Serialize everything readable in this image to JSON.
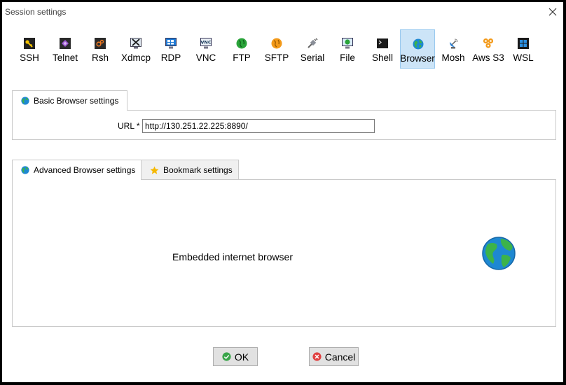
{
  "window": {
    "title": "Session settings"
  },
  "session_types": [
    {
      "label": "SSH",
      "icon": "key-icon"
    },
    {
      "label": "Telnet",
      "icon": "telnet-icon"
    },
    {
      "label": "Rsh",
      "icon": "rsh-icon"
    },
    {
      "label": "Xdmcp",
      "icon": "xdmcp-icon"
    },
    {
      "label": "RDP",
      "icon": "rdp-monitor-icon"
    },
    {
      "label": "VNC",
      "icon": "vnc-monitor-icon"
    },
    {
      "label": "FTP",
      "icon": "ftp-globe-icon"
    },
    {
      "label": "SFTP",
      "icon": "sftp-icon"
    },
    {
      "label": "Serial",
      "icon": "serial-plug-icon"
    },
    {
      "label": "File",
      "icon": "file-monitor-icon"
    },
    {
      "label": "Shell",
      "icon": "shell-terminal-icon"
    },
    {
      "label": "Browser",
      "icon": "browser-globe-icon",
      "selected": true
    },
    {
      "label": "Mosh",
      "icon": "mosh-satellite-icon"
    },
    {
      "label": "Aws S3",
      "icon": "aws-s3-icon"
    },
    {
      "label": "WSL",
      "icon": "windows-icon"
    }
  ],
  "basic": {
    "tab_label": "Basic Browser settings",
    "url_label": "URL *",
    "url_value": "http://130.251.22.225:8890/"
  },
  "advanced_tabs": {
    "advanced_label": "Advanced Browser settings",
    "bookmark_label": "Bookmark settings"
  },
  "embedded": {
    "text": "Embedded internet browser"
  },
  "buttons": {
    "ok": "OK",
    "cancel": "Cancel"
  },
  "colors": {
    "selected_bg": "#cce4f7",
    "globe_ocean": "#1e88d2",
    "globe_land": "#3cb34a",
    "ok_green": "#3aa54a",
    "cancel_red": "#e04040",
    "star_yellow": "#f5b800"
  }
}
